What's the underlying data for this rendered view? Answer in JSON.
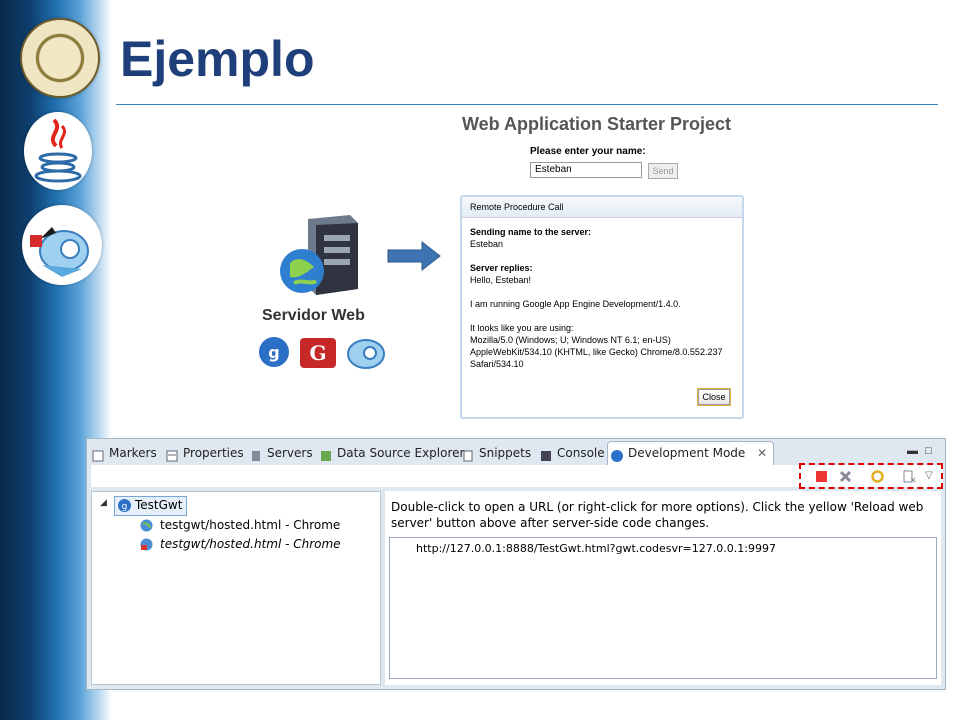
{
  "slide": {
    "title": "Ejemplo"
  },
  "gwt_app": {
    "title": "Web Application Starter Project",
    "name_label": "Please enter your name:",
    "name_value": "Esteban",
    "send_label": "Send",
    "dialog": {
      "caption": "Remote Procedure Call",
      "sending_heading": "Sending name to the server:",
      "sending_value": "Esteban",
      "replies_heading": "Server replies:",
      "reply": "Hello, Esteban!",
      "running": "I am running Google App Engine Development/1.4.0.",
      "using": "It looks like you are using:",
      "ua_line1": "Mozilla/5.0 (Windows; U; Windows NT 6.1; en-US)",
      "ua_line2": "AppleWebKit/534.10 (KHTML, like Gecko) Chrome/8.0.552.237",
      "ua_line3": "Safari/534.10",
      "close_label": "Close"
    }
  },
  "server": {
    "label": "Servidor Web"
  },
  "eclipse": {
    "tabs": [
      {
        "label": "Markers"
      },
      {
        "label": "Properties"
      },
      {
        "label": "Servers"
      },
      {
        "label": "Data Source Explorer"
      },
      {
        "label": "Snippets"
      },
      {
        "label": "Console"
      },
      {
        "label": "Development Mode"
      }
    ],
    "tree": {
      "root": "TestGwt",
      "children": [
        "testgwt/hosted.html - Chrome",
        "testgwt/hosted.html - Chrome"
      ]
    },
    "instructions": "Double-click to open a URL (or right-click for more options). Click the yellow 'Reload web server' button above after server-side code changes.",
    "url": "http://127.0.0.1:8888/TestGwt.html?gwt.codesvr=127.0.0.1:9997"
  },
  "colors": {
    "title": "#1e3f7a",
    "highlight_box": "#d00000",
    "tab_bar": "#dfe7f1"
  }
}
